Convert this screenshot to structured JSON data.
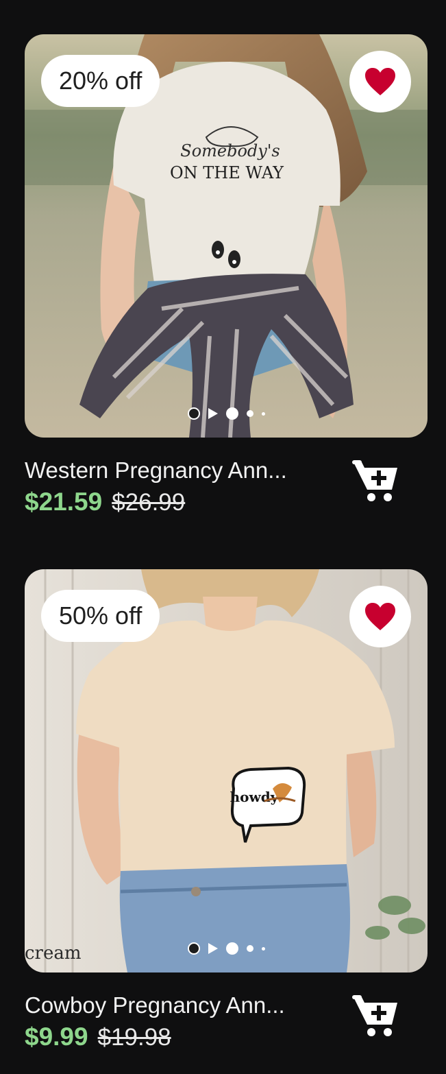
{
  "products": [
    {
      "title": "Western Pregnancy Ann...",
      "discount_badge": "20% off",
      "price": "$21.59",
      "original_price": "$26.99",
      "favorited": true,
      "shirt_text_script": "Somebody's",
      "shirt_text_main": "ON THE WAY"
    },
    {
      "title": "Cowboy Pregnancy Ann...",
      "discount_badge": "50% off",
      "price": "$9.99",
      "original_price": "$19.98",
      "favorited": true,
      "shirt_text_main": "howdy",
      "watermark": "cream"
    }
  ],
  "icons": {
    "favorite": "heart-icon",
    "cart": "add-to-cart-icon",
    "play": "play-icon"
  },
  "colors": {
    "background": "#0f0f10",
    "sale_price": "#8ed68c",
    "heart": "#c7002f",
    "badge_bg": "#ffffff"
  }
}
